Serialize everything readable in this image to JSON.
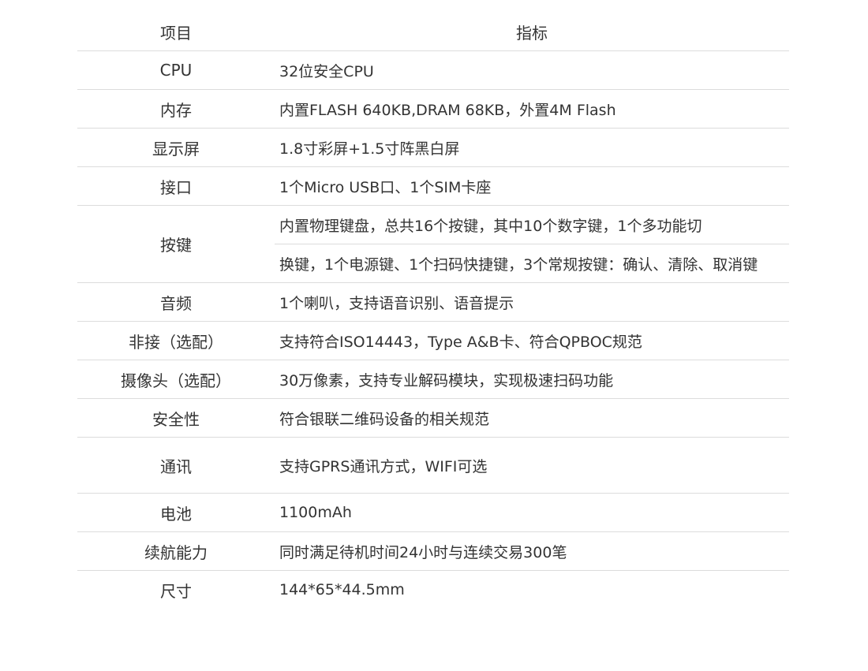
{
  "table": {
    "header": {
      "label": "项目",
      "value": "指标"
    },
    "rows": [
      {
        "label": "CPU",
        "value": "32位安全CPU"
      },
      {
        "label": "内存",
        "value": "内置FLASH 640KB,DRAM 68KB，外置4M Flash"
      },
      {
        "label": "显示屏",
        "value": "1.8寸彩屏+1.5寸阵黑白屏"
      },
      {
        "label": "接口",
        "value": "1个Micro USB口、1个SIM卡座"
      },
      {
        "label": "按键",
        "value_line1": "内置物理键盘，总共16个按键，其中10个数字键，1个多功能切",
        "value_line2": "换键，1个电源键、1个扫码快捷键，3个常规按键：确认、清除、取消键"
      },
      {
        "label": "音频",
        "value": "1个喇叭，支持语音识别、语音提示"
      },
      {
        "label": "非接（选配）",
        "value": "支持符合ISO14443，Type A&B卡、符合QPBOC规范"
      },
      {
        "label": "摄像头（选配）",
        "value": "30万像素，支持专业解码模块，实现极速扫码功能"
      },
      {
        "label": "安全性",
        "value": "符合银联二维码设备的相关规范"
      },
      {
        "label": "通讯",
        "value": "支持GPRS通讯方式，WIFI可选"
      },
      {
        "label": "电池",
        "value": "1100mAh"
      },
      {
        "label": "续航能力",
        "value": "同时满足待机时间24小时与连续交易300笔"
      },
      {
        "label": "尺寸",
        "value": "144*65*44.5mm"
      }
    ]
  }
}
